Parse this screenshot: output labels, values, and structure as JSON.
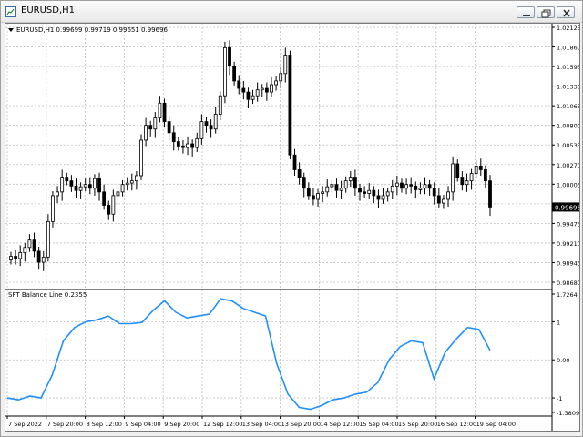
{
  "window": {
    "title": "EURUSD,H1",
    "controls": {
      "minimize": "minimize",
      "restore": "restore",
      "close": "close"
    }
  },
  "colors": {
    "window_frame": "#f0f0f0",
    "grid": "#c0c0c0",
    "candle": "#000000",
    "indicator_line": "#1e90ff",
    "price_label_bg": "#000000",
    "price_label_fg": "#ffffff"
  },
  "price_panel": {
    "symbol_info": "EURUSD,H1  0.99699 0.99719 0.99651 0.99696",
    "current_price": "0.99696",
    "axis_labels": [
      "1.02125",
      "1.01860",
      "1.01595",
      "1.01330",
      "1.01065",
      "1.00800",
      "1.00535",
      "1.00270",
      "1.00005",
      "0.99740",
      "0.99475",
      "0.99210",
      "0.98945",
      "0.98680"
    ]
  },
  "indicator_panel": {
    "label": "SFT Balance Line 0.2355",
    "axis_labels": [
      "1.7264",
      "1",
      "0.00",
      "-1",
      "-1.3809"
    ]
  },
  "time_axis": {
    "labels": [
      "7 Sep 2022",
      "7 Sep 20:00",
      "8 Sep 12:00",
      "9 Sep 04:00",
      "9 Sep 20:00",
      "12 Sep 12:00",
      "13 Sep 04:00",
      "13 Sep 20:00",
      "14 Sep 12:00",
      "15 Sep 04:00",
      "15 Sep 20:00",
      "16 Sep 12:00",
      "19 Sep 04:00"
    ]
  },
  "chart_data": [
    {
      "type": "candlestick",
      "ylim": [
        0.9868,
        1.02125
      ],
      "series": [
        {
          "name": "EURUSD,H1",
          "close": [
            0.9903,
            0.99,
            0.9908,
            0.9915,
            0.9925,
            0.991,
            0.9895,
            0.9902,
            0.995,
            0.9985,
            0.999,
            1.001,
            1.0005,
            0.9998,
            0.9992,
            0.9997,
            1.0,
            0.9995,
            1.0008,
            0.999,
            0.9972,
            0.996,
            0.9985,
            0.999,
            1.0,
            1.0002,
            1.0005,
            1.0012,
            1.006,
            1.008,
            1.0075,
            1.009,
            1.011,
            1.0085,
            1.007,
            1.0058,
            1.0052,
            1.005,
            1.0055,
            1.005,
            1.0062,
            1.0085,
            1.008,
            1.0075,
            1.0095,
            1.012,
            1.0185,
            1.016,
            1.014,
            1.013,
            1.0125,
            1.0115,
            1.012,
            1.0128,
            1.013,
            1.0125,
            1.0135,
            1.014,
            1.015,
            1.0175,
            1.004,
            1.002,
            1.001,
            0.9995,
            0.9985,
            0.998,
            0.9988,
            0.999,
            0.9997,
            1.0,
            0.9992,
            0.9995,
            1.0005,
            1.001,
            0.9995,
            0.999,
            0.9988,
            0.9992,
            0.9985,
            0.998,
            0.9985,
            0.999,
            0.9998,
            1.0002,
            0.9995,
            1.0,
            0.9998,
            0.9993,
            0.9995,
            1.0,
            0.9995,
            0.9985,
            0.9975,
            0.998,
            0.999,
            1.0028,
            1.001,
            1.0,
            1.0005,
            1.0015,
            1.0025,
            1.002,
            1.0005,
            0.99696
          ]
        }
      ]
    },
    {
      "type": "line",
      "ylim": [
        -1.3809,
        1.7264
      ],
      "series": [
        {
          "name": "SFT Balance Line",
          "values": [
            -1.0,
            -1.05,
            -0.95,
            -1.0,
            -0.4,
            0.5,
            0.85,
            1.0,
            1.05,
            1.15,
            0.95,
            0.95,
            0.98,
            1.3,
            1.55,
            1.25,
            1.1,
            1.15,
            1.2,
            1.6,
            1.55,
            1.35,
            1.25,
            1.15,
            -0.1,
            -0.9,
            -1.25,
            -1.3,
            -1.2,
            -1.05,
            -1.0,
            -0.9,
            -0.85,
            -0.6,
            0.0,
            0.35,
            0.5,
            0.45,
            -0.5,
            0.2,
            0.55,
            0.85,
            0.8,
            0.25
          ]
        }
      ]
    }
  ]
}
